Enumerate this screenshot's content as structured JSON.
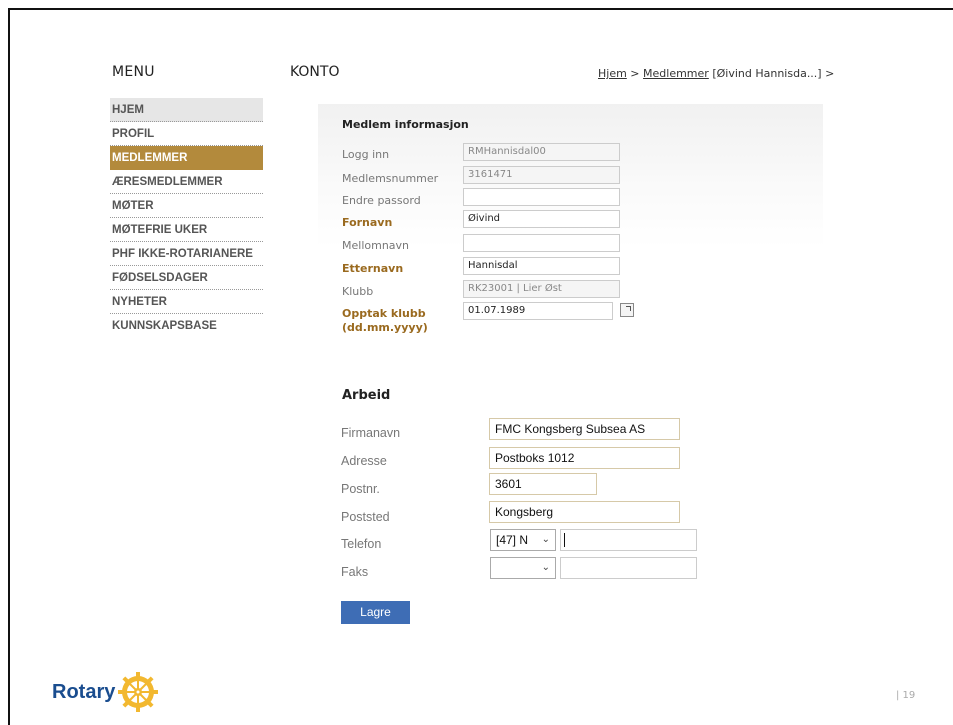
{
  "menu": {
    "title": "MENU",
    "items": [
      "HJEM",
      "PROFIL",
      "MEDLEMMER",
      "ÆRESMEDLEMMER",
      "MØTER",
      "MØTEFRIE UKER",
      "PHF IKKE-ROTARIANERE",
      "FØDSELSDAGER",
      "NYHETER",
      "KUNNSKAPSBASE"
    ],
    "active": "MEDLEMMER"
  },
  "page": {
    "title": "KONTO",
    "breadcrumb": {
      "home": "Hjem",
      "sep1": " > ",
      "members": "Medlemmer",
      "current": " [Øivind Hannisda...] > |"
    }
  },
  "member_info": {
    "title": "Medlem informasjon",
    "login_label": "Logg inn",
    "login_value": "RMHannisdal00",
    "member_no_label": "Medlemsnummer",
    "member_no_value": "3161471",
    "password_label": "Endre passord",
    "password_value": "",
    "firstname_label": "Fornavn",
    "firstname_value": "Øivind",
    "middlename_label": "Mellomnavn",
    "middlename_value": "",
    "lastname_label": "Etternavn",
    "lastname_value": "Hannisdal",
    "club_label": "Klubb",
    "club_value": "RK23001 | Lier Øst",
    "join_label_1": "Opptak klubb",
    "join_label_2": "(dd.mm.yyyy)",
    "join_value": "01.07.1989"
  },
  "work": {
    "title": "Arbeid",
    "company_label": "Firmanavn",
    "company_value": "FMC Kongsberg Subsea AS",
    "address_label": "Adresse",
    "address_value": "Postboks 1012",
    "postno_label": "Postnr.",
    "postno_value": "3601",
    "city_label": "Poststed",
    "city_value": "Kongsberg",
    "phone_label": "Telefon",
    "phone_code": "[47] N",
    "phone_value": "",
    "fax_label": "Faks",
    "fax_code": "",
    "fax_value": ""
  },
  "save_label": "Lagre",
  "logo_text": "Rotary",
  "page_number": "| 19",
  "colors": {
    "accent_gold": "#b38a3c",
    "button_blue": "#3e6db5",
    "logo_blue": "#1a4d8f",
    "wheel_gold": "#f2b830"
  }
}
